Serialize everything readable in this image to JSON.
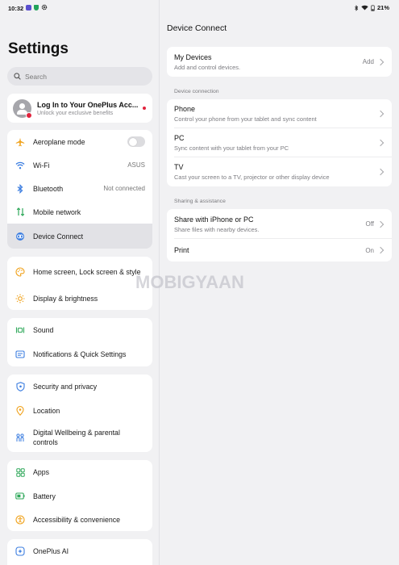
{
  "status_bar": {
    "time": "10:32",
    "battery": "21%"
  },
  "settings": {
    "title": "Settings",
    "search_placeholder": "Search",
    "account": {
      "title": "Log In to Your OnePlus Acc...",
      "subtitle": "Unlock your exclusive benefits"
    },
    "group1": [
      {
        "label": "Aeroplane mode",
        "icon": "airplane-icon",
        "control": "toggle",
        "toggle_on": false
      },
      {
        "label": "Wi-Fi",
        "icon": "wifi-icon",
        "value": "ASUS"
      },
      {
        "label": "Bluetooth",
        "icon": "bluetooth-icon",
        "value": "Not connected"
      },
      {
        "label": "Mobile network",
        "icon": "mobile-network-icon"
      },
      {
        "label": "Device Connect",
        "icon": "device-connect-icon",
        "active": true
      }
    ],
    "group2": [
      {
        "label": "Home screen, Lock screen & style",
        "icon": "palette-icon"
      },
      {
        "label": "Display & brightness",
        "icon": "sun-icon"
      }
    ],
    "group3": [
      {
        "label": "Sound",
        "icon": "sound-icon"
      },
      {
        "label": "Notifications & Quick Settings",
        "icon": "notifications-icon"
      }
    ],
    "group4": [
      {
        "label": "Security and privacy",
        "icon": "shield-icon"
      },
      {
        "label": "Location",
        "icon": "location-icon"
      },
      {
        "label": "Digital Wellbeing & parental controls",
        "icon": "wellbeing-icon"
      }
    ],
    "group5": [
      {
        "label": "Apps",
        "icon": "apps-icon"
      },
      {
        "label": "Battery",
        "icon": "battery-icon"
      },
      {
        "label": "Accessibility & convenience",
        "icon": "accessibility-icon"
      }
    ],
    "group6": [
      {
        "label": "OnePlus AI",
        "icon": "ai-icon"
      }
    ]
  },
  "device_connect": {
    "title": "Device Connect",
    "my_devices": {
      "title": "My Devices",
      "subtitle": "Add and control devices.",
      "action": "Add"
    },
    "section_connection": "Device connection",
    "connection_items": [
      {
        "title": "Phone",
        "subtitle": "Control your phone from your tablet and sync content"
      },
      {
        "title": "PC",
        "subtitle": "Sync content with your tablet from your PC"
      },
      {
        "title": "TV",
        "subtitle": "Cast your screen to a TV, projector or other display device"
      }
    ],
    "section_sharing": "Sharing & assistance",
    "sharing_items": [
      {
        "title": "Share with iPhone or PC",
        "subtitle": "Share files with nearby devices.",
        "value": "Off"
      },
      {
        "title": "Print",
        "value": "On"
      }
    ]
  },
  "watermark": "MOBIGYAAN",
  "colors": {
    "accent": "#e1233d",
    "page_bg": "#f1f1f3",
    "card_bg": "#ffffff",
    "active_row": "#e2e2e6"
  }
}
